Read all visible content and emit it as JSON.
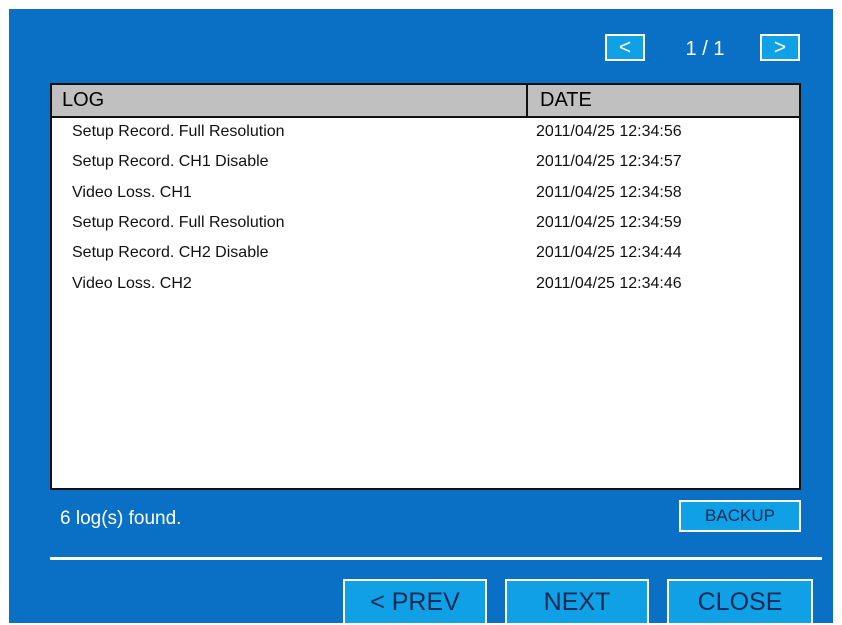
{
  "pager": {
    "prev_symbol": "<",
    "next_symbol": ">",
    "page_indicator": "1 / 1"
  },
  "table": {
    "columns": [
      "LOG",
      "DATE"
    ],
    "rows": [
      {
        "log": "Setup Record. Full  Resolution",
        "date": "2011/04/25  12:34:56"
      },
      {
        "log": "Setup Record. CH1 Disable",
        "date": "2011/04/25  12:34:57"
      },
      {
        "log": "Video Loss. CH1",
        "date": "2011/04/25  12:34:58"
      },
      {
        "log": "Setup Record. Full  Resolution",
        "date": "2011/04/25  12:34:59"
      },
      {
        "log": "Setup Record. CH2 Disable",
        "date": "2011/04/25  12:34:44"
      },
      {
        "log": "Video Loss. CH2",
        "date": "2011/04/25  12:34:46"
      }
    ]
  },
  "status": {
    "text": "6 log(s) found."
  },
  "buttons": {
    "backup": "BACKUP",
    "prev": "< PREV",
    "next": "NEXT",
    "close": "CLOSE"
  },
  "colors": {
    "panel": "#0a70c6",
    "button": "#10a0e6",
    "header": "#c0c0c0"
  }
}
